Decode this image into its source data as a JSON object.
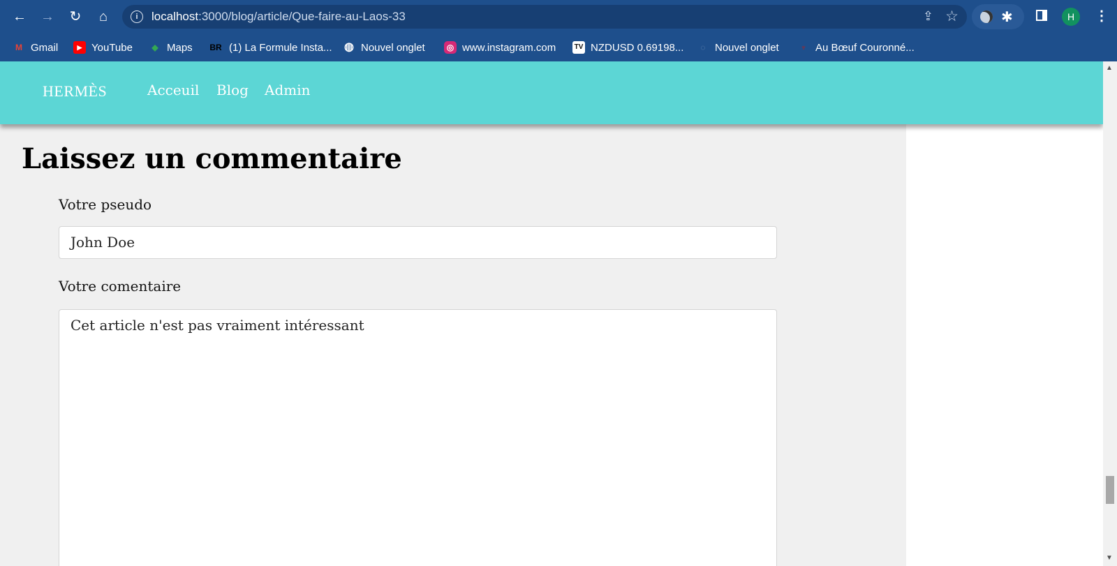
{
  "browser": {
    "url_host": "localhost",
    "url_rest": ":3000/blog/article/Que-faire-au-Laos-33",
    "profile_initial": "H"
  },
  "bookmarks": [
    {
      "label": "Gmail",
      "icon": "gmail-icon",
      "color": "#ea4335",
      "glyph": "M"
    },
    {
      "label": "YouTube",
      "icon": "youtube-icon",
      "color": "#ff0000",
      "glyph": "▶"
    },
    {
      "label": "Maps",
      "icon": "maps-icon",
      "color": "#34a853",
      "glyph": "◆"
    },
    {
      "label": "(1) La Formule Insta...",
      "icon": "br-icon",
      "color": "#1e4f8c",
      "glyph": "BR"
    },
    {
      "label": "Nouvel onglet",
      "icon": "globe-icon",
      "color": "#ffffff",
      "glyph": "◍"
    },
    {
      "label": "www.instagram.com",
      "icon": "instagram-icon",
      "color": "#d62976",
      "glyph": "◎"
    },
    {
      "label": "NZDUSD 0.69198...",
      "icon": "tradingview-icon",
      "color": "#111111",
      "glyph": "TV"
    },
    {
      "label": "Nouvel onglet",
      "icon": "blank-tab-icon",
      "color": "#3a5f8f",
      "glyph": "◌"
    },
    {
      "label": "Au Bœuf Couronné...",
      "icon": "boeuf-icon",
      "color": "#b22222",
      "glyph": "♆"
    }
  ],
  "site": {
    "logo": "HERMÈS",
    "nav": [
      "Acceuil",
      "Blog",
      "Admin"
    ],
    "header_color": "#5cd6d5"
  },
  "comment_form": {
    "heading": "Laissez un commentaire",
    "pseudo_label": "Votre pseudo",
    "pseudo_value": "John Doe",
    "comment_label": "Votre comentaire",
    "comment_value": "Cet article n'est pas vraiment intéressant"
  }
}
